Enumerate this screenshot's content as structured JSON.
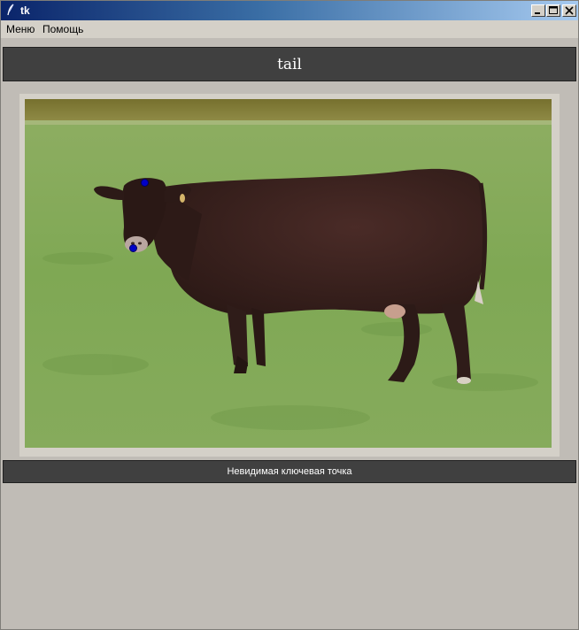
{
  "window": {
    "title": "tk"
  },
  "menu": {
    "items": [
      "Меню",
      "Помощь"
    ]
  },
  "header": {
    "label": "tail"
  },
  "footer": {
    "status": "Невидимая ключевая точка"
  },
  "image": {
    "subject": "cow",
    "keypoints_count": 2
  }
}
